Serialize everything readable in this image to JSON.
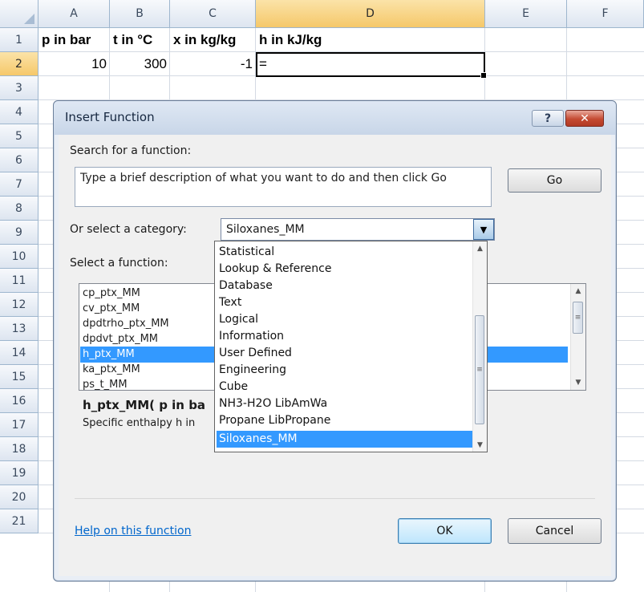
{
  "sheet": {
    "columns": [
      "A",
      "B",
      "C",
      "D",
      "E",
      "F"
    ],
    "selected_column": "D",
    "rows": [
      "1",
      "2",
      "3",
      "4",
      "5",
      "6",
      "7",
      "8",
      "9",
      "10",
      "11",
      "12",
      "13",
      "14",
      "15",
      "16",
      "17",
      "18",
      "19",
      "20",
      "21"
    ],
    "selected_row": "2",
    "header_row": [
      "p in bar",
      "t in °C",
      "x in kg/kg",
      "h in kJ/kg"
    ],
    "data_row": [
      "10",
      "300",
      "-1",
      "="
    ],
    "active_cell": "D2"
  },
  "dialog": {
    "title": "Insert Function",
    "help_button": "?",
    "close_button": "✕",
    "search_label": "Search for a function:",
    "search_text": "Type a brief description of what you want to do and then click Go",
    "go_button": "Go",
    "category_label": "Or select a category:",
    "category_value": "Siloxanes_MM",
    "function_label": "Select a function:",
    "functions": [
      "cp_ptx_MM",
      "cv_ptx_MM",
      "dpdtrho_ptx_MM",
      "dpdvt_ptx_MM",
      "h_ptx_MM",
      "ka_ptx_MM",
      "ps_t_MM"
    ],
    "selected_function": "h_ptx_MM",
    "signature": "h_ptx_MM( p in ba",
    "description": "Specific enthalpy h in",
    "help_link": "Help on this function",
    "ok_button": "OK",
    "cancel_button": "Cancel"
  },
  "category_dropdown": {
    "items": [
      "Statistical",
      "Lookup & Reference",
      "Database",
      "Text",
      "Logical",
      "Information",
      "User Defined",
      "Engineering",
      "Cube",
      "NH3-H2O LibAmWa",
      "Propane LibPropane",
      "Siloxanes_MM"
    ],
    "selected": "Siloxanes_MM"
  },
  "colors": {
    "selection": "#3399ff",
    "header_highlight": "#f5c86a",
    "close_button": "#c44a32",
    "link": "#0066cc"
  },
  "icons": {
    "dropdown_arrow": "▼",
    "scroll_up": "▲",
    "scroll_down": "▼",
    "thumb_grip": "≡"
  }
}
